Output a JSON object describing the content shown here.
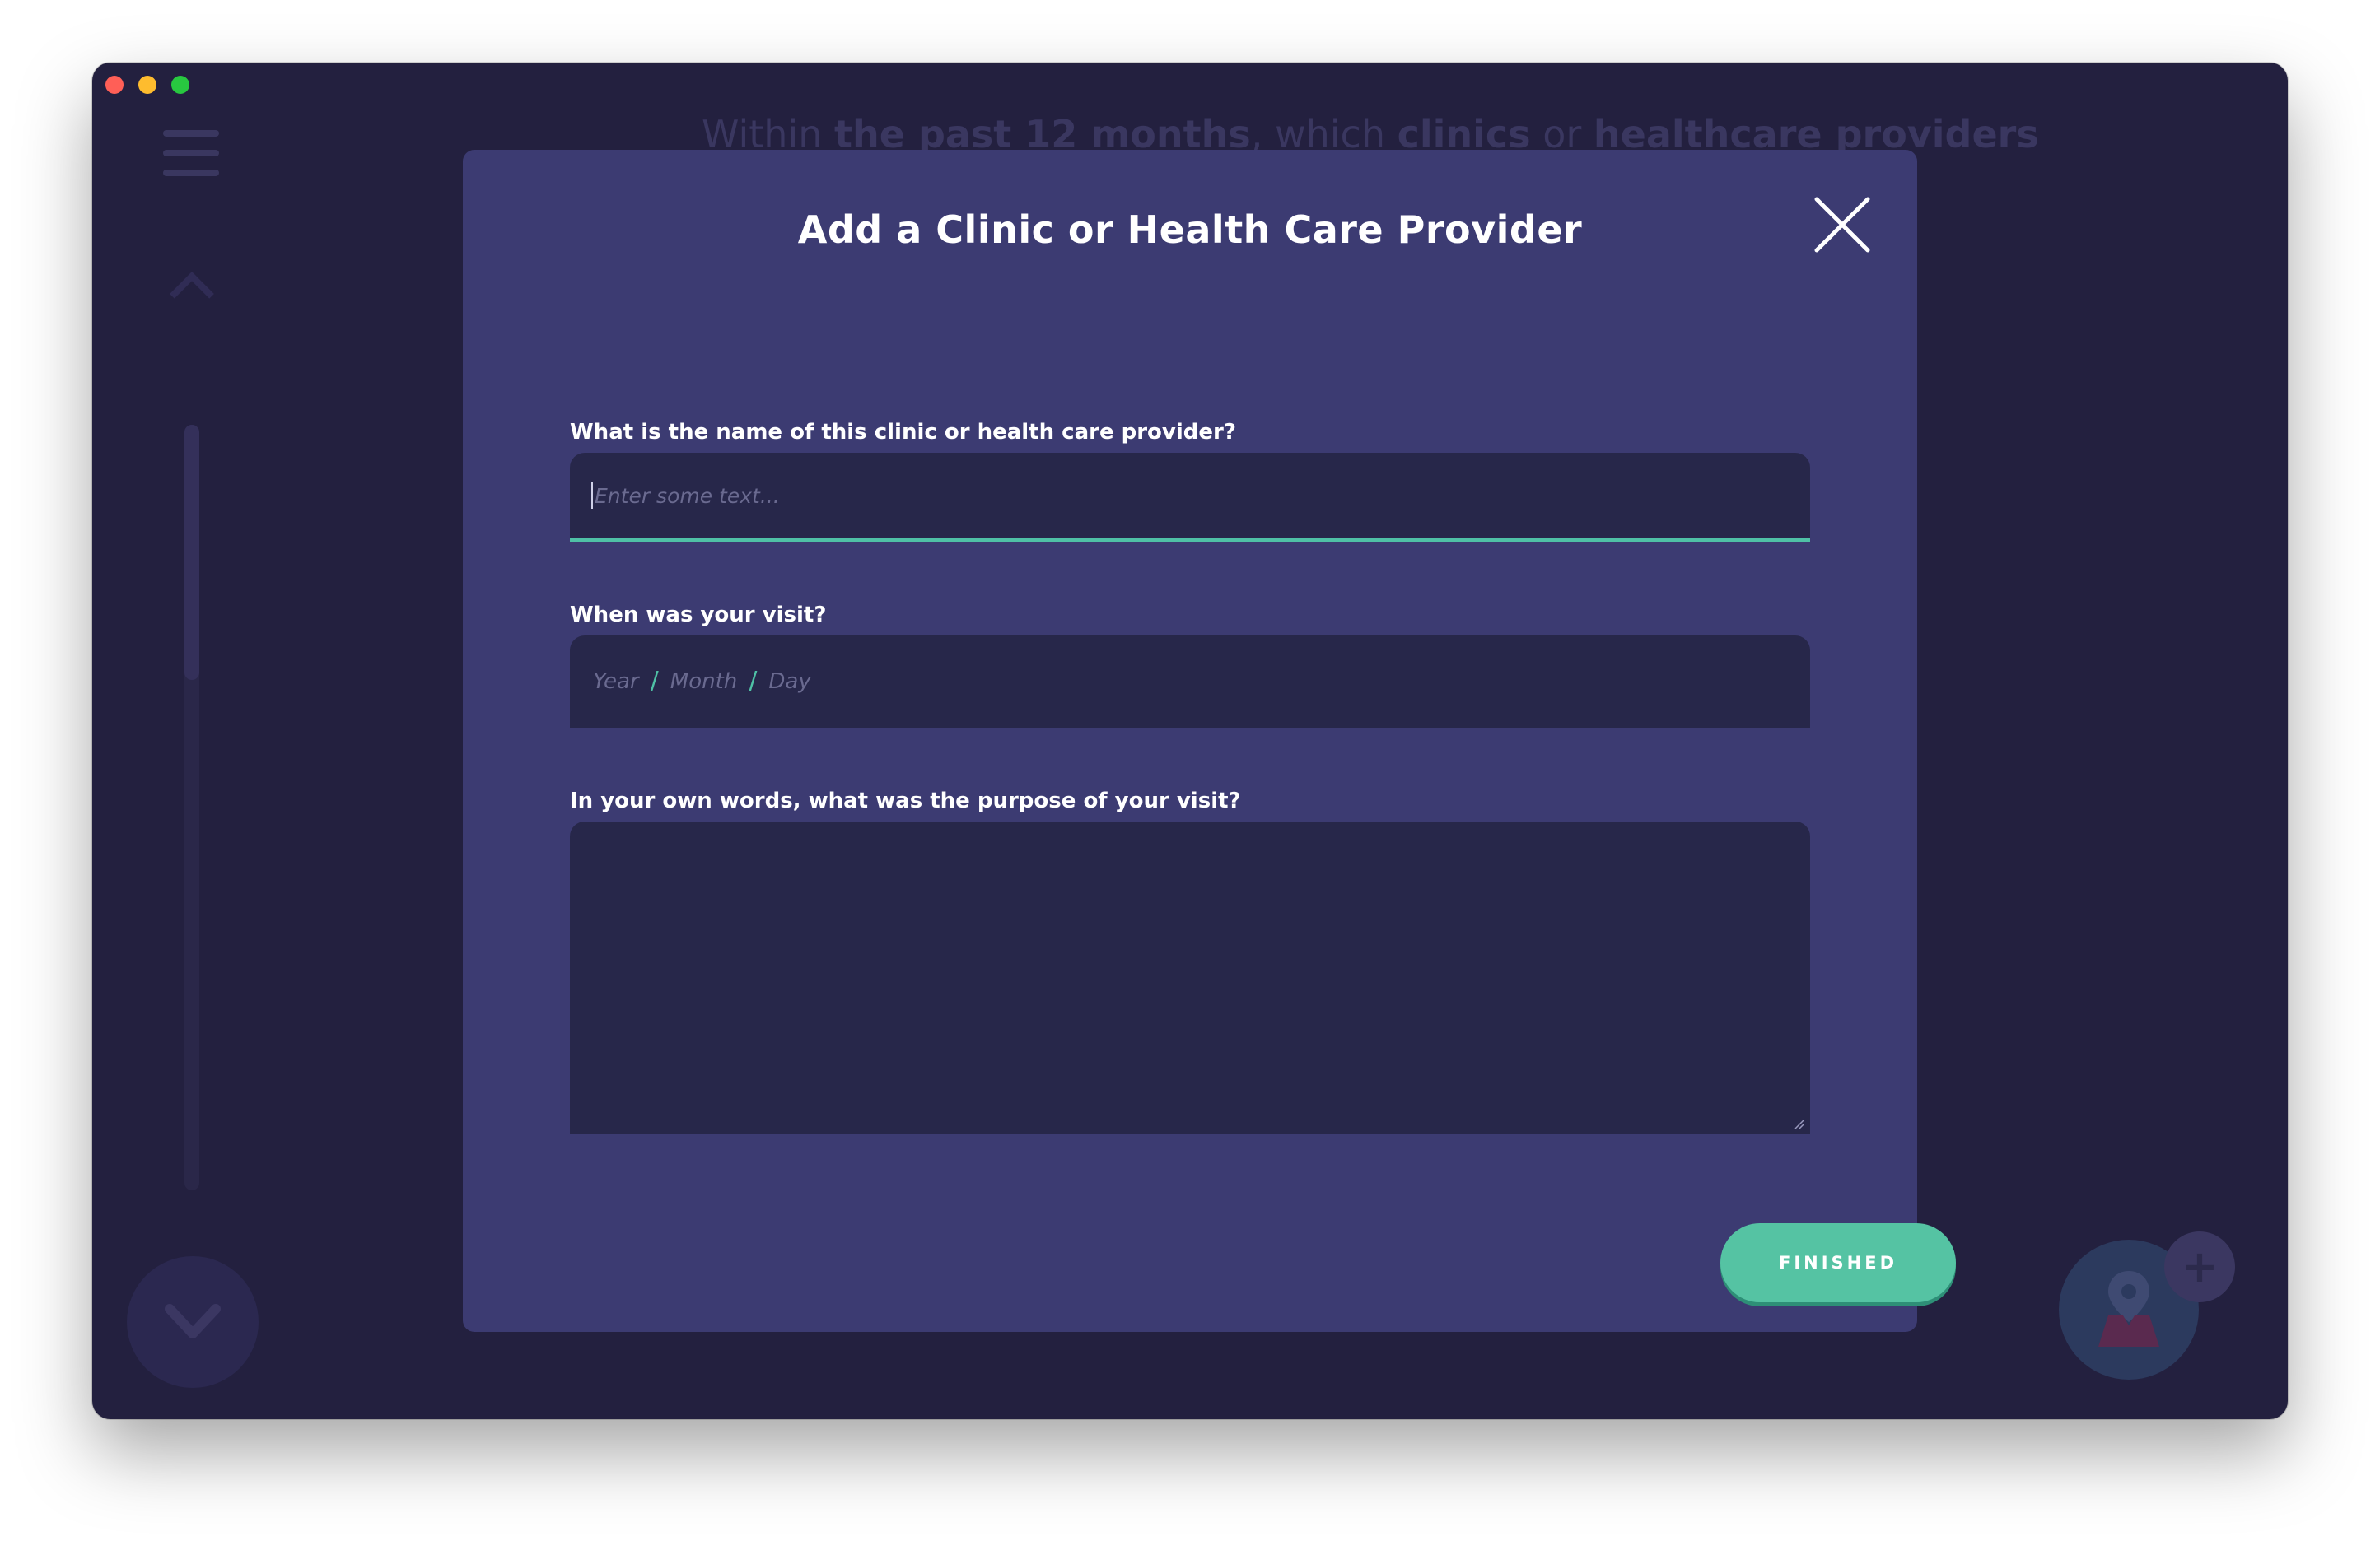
{
  "window": {
    "controls": [
      "close",
      "minimize",
      "zoom"
    ]
  },
  "background": {
    "question_parts": [
      {
        "text": "Within ",
        "bold": false
      },
      {
        "text": "the past 12 months",
        "bold": true
      },
      {
        "text": ", which ",
        "bold": false
      },
      {
        "text": "clinics",
        "bold": true
      },
      {
        "text": " or ",
        "bold": false
      },
      {
        "text": "healthcare providers",
        "bold": true
      }
    ],
    "icons": [
      "menu-icon",
      "chevron-up-icon",
      "chevron-down-icon",
      "map-pin-icon",
      "plus-icon"
    ]
  },
  "modal": {
    "title": "Add a Clinic or Health Care Provider",
    "close_icon": "close-icon",
    "fields": {
      "name_label": "What is the name of this clinic or health care provider?",
      "name_placeholder": "Enter some text...",
      "date_label": "When was your visit?",
      "date_year": "Year",
      "date_month": "Month",
      "date_day": "Day",
      "date_separator": "/",
      "purpose_label": "In your own words, what was the purpose of your visit?",
      "purpose_value": ""
    },
    "finished_label": "FINISHED"
  },
  "colors": {
    "window_bg": "#23203f",
    "modal_bg": "#3c3b72",
    "input_bg": "#27274a",
    "accent": "#55c3a3"
  }
}
